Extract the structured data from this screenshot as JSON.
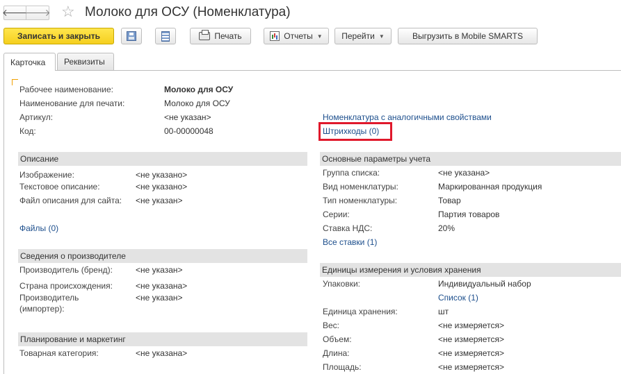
{
  "header": {
    "title": "Молоко для ОСУ (Номенклатура)",
    "back_glyph": "🡐",
    "forward_glyph": "🡒",
    "star_glyph": "☆"
  },
  "toolbar": {
    "save_close_label": "Записать и закрыть",
    "print_label": "Печать",
    "reports_label": "Отчеты",
    "goto_label": "Перейти",
    "export_label": "Выгрузить в Mobile SMARTS",
    "caret": "▼"
  },
  "tabs": [
    {
      "label": "Карточка",
      "active": true
    },
    {
      "label": "Реквизиты",
      "active": false
    }
  ],
  "main": {
    "work_name": {
      "label": "Рабочее наименование:",
      "value": "Молоко для ОСУ"
    },
    "print_name": {
      "label": "Наименование для печати:",
      "value": "Молоко для ОСУ"
    },
    "article": {
      "label": "Артикул:",
      "value": "<не указан>"
    },
    "code": {
      "label": "Код:",
      "value": "00-00000048"
    },
    "similar_link": "Номенклатура с аналогичными свойствами",
    "barcodes_link": "Штрихкоды (0)"
  },
  "description": {
    "title": "Описание",
    "image": {
      "label": "Изображение:",
      "value": "<не указано>"
    },
    "text_desc": {
      "label": "Текстовое описание:",
      "value": "<не указано>"
    },
    "site_file": {
      "label": "Файл описания для сайта:",
      "value": "<не указан>"
    },
    "files_link": "Файлы (0)"
  },
  "manufacturer": {
    "title": "Сведения о производителе",
    "brand": {
      "label": "Производитель (бренд):",
      "value": "<не указан>"
    },
    "country": {
      "label": "Страна происхождения:",
      "value": "<не указана>"
    },
    "importer_label_1": "Производитель",
    "importer_label_2": "(импортер):",
    "importer_value": "<не указан>"
  },
  "planning": {
    "title": "Планирование и маркетинг",
    "category": {
      "label": "Товарная категория:",
      "value": "<не указана>"
    }
  },
  "accounting": {
    "title": "Основные параметры учета",
    "group": {
      "label": "Группа списка:",
      "value": "<не указана>"
    },
    "kind": {
      "label": "Вид номенклатуры:",
      "value": "Маркированная продукция"
    },
    "type": {
      "label": "Тип номенклатуры:",
      "value": "Товар"
    },
    "series": {
      "label": "Серии:",
      "value": "Партия товаров"
    },
    "vat": {
      "label": "Ставка НДС:",
      "value": "20%"
    },
    "all_rates_link": "Все ставки (1)"
  },
  "units": {
    "title": "Единицы измерения и условия хранения",
    "packs": {
      "label": "Упаковки:",
      "value": "Индивидуальный набор"
    },
    "list_link": "Список (1)",
    "storage_unit": {
      "label": "Единица хранения:",
      "value": "шт"
    },
    "weight": {
      "label": "Вес:",
      "value": "<не измеряется>"
    },
    "volume": {
      "label": "Объем:",
      "value": "<не измеряется>"
    },
    "length": {
      "label": "Длина:",
      "value": "<не измеряется>"
    },
    "area": {
      "label": "Площадь:",
      "value": "<не измеряется>"
    }
  },
  "colors": {
    "primary_button": "#f5cf1f",
    "link": "#1c4e8c",
    "highlight": "#e0182b",
    "section_bg": "#e3e3e3"
  }
}
